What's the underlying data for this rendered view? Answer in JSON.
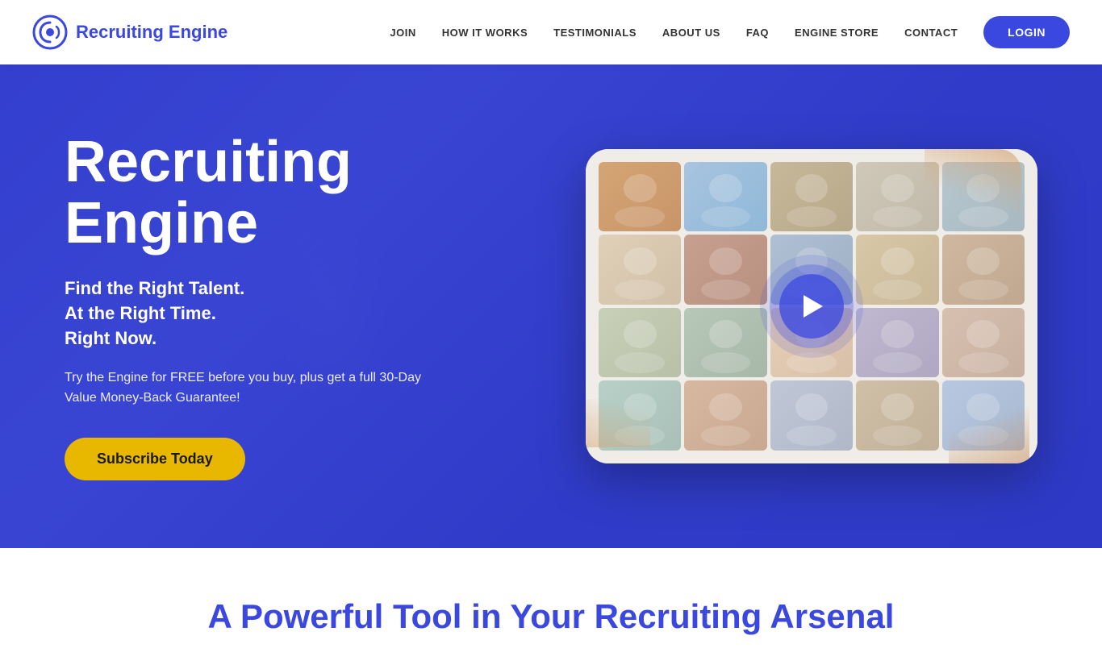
{
  "header": {
    "logo_text_part1": "Recruiting ",
    "logo_text_part2": "Engine",
    "nav": {
      "items": [
        {
          "label": "JOIN",
          "id": "join"
        },
        {
          "label": "HOW IT WORKS",
          "id": "how-it-works"
        },
        {
          "label": "TESTIMONIALS",
          "id": "testimonials"
        },
        {
          "label": "ABOUT US",
          "id": "about-us"
        },
        {
          "label": "FAQ",
          "id": "faq"
        },
        {
          "label": "ENGINE STORE",
          "id": "engine-store"
        },
        {
          "label": "CONTACT",
          "id": "contact"
        }
      ],
      "login_label": "LOGIN"
    }
  },
  "hero": {
    "title_line1": "Recruiting",
    "title_line2": "Engine",
    "subtitle_line1": "Find the Right Talent.",
    "subtitle_line2": "At the Right Time.",
    "subtitle_line3": "Right Now.",
    "description": "Try the Engine for FREE before you buy, plus get a full 30-Day Value Money-Back Guarantee!",
    "cta_label": "Subscribe Today"
  },
  "video": {
    "play_label": "Play Video"
  },
  "bottom": {
    "title": "A Powerful Tool in Your Recruiting Arsenal"
  },
  "colors": {
    "primary": "#3b48e0",
    "cta_bg": "#e8b800",
    "login_bg": "#3b48e0",
    "hero_bg": "#3b48e0",
    "white": "#ffffff"
  }
}
